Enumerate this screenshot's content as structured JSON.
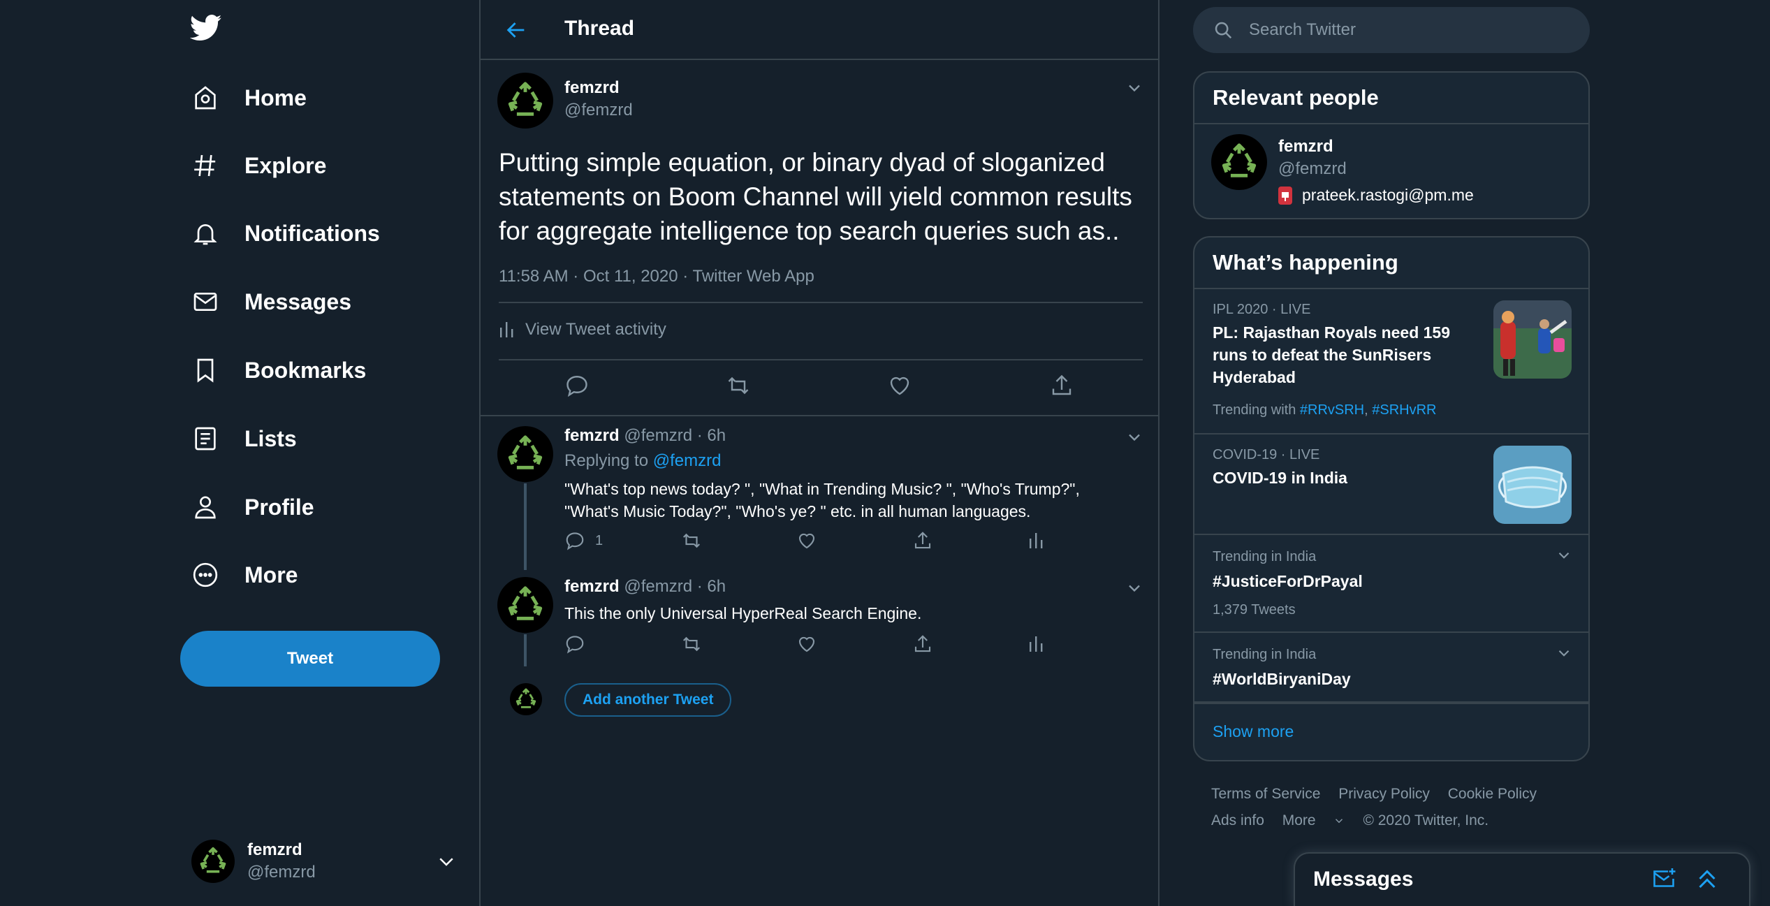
{
  "colors": {
    "background": "#15202b",
    "panel": "#192734",
    "border": "#38444d",
    "accent": "#1da1f2",
    "tweet_button": "#1a82c9",
    "muted": "#8899a6",
    "recycle_green": "#77b255"
  },
  "nav": {
    "logo_icon": "twitter-bird-icon",
    "items": [
      {
        "label": "Home",
        "icon": "home-icon"
      },
      {
        "label": "Explore",
        "icon": "hashtag-icon"
      },
      {
        "label": "Notifications",
        "icon": "bell-icon"
      },
      {
        "label": "Messages",
        "icon": "envelope-icon"
      },
      {
        "label": "Bookmarks",
        "icon": "bookmark-icon"
      },
      {
        "label": "Lists",
        "icon": "list-icon"
      },
      {
        "label": "Profile",
        "icon": "person-icon"
      },
      {
        "label": "More",
        "icon": "more-circle-icon"
      }
    ],
    "tweet_button": "Tweet",
    "account": {
      "name": "femzrd",
      "handle": "@femzrd"
    }
  },
  "thread": {
    "title": "Thread",
    "main_tweet": {
      "name": "femzrd",
      "handle": "@femzrd",
      "text": "Putting simple equation, or binary dyad of sloganized statements on Boom Channel will yield common results for aggregate intelligence top search queries such as..",
      "meta": "11:58 AM · Oct 11, 2020 · Twitter Web App",
      "activity": "View Tweet activity"
    },
    "replies": [
      {
        "name": "femzrd",
        "handle": "@femzrd",
        "time": " · 6h",
        "replying_prefix": "Replying to ",
        "replying_to": "@femzrd",
        "line1": "\"What's top news today? \", \"What in Trending Music? \",  \"Who's  Trump?\",",
        "line2": "\"What's Music Today?\", \"Who's ye? \" etc. in all human languages.",
        "reply_count": "1"
      },
      {
        "name": "femzrd",
        "handle": "@femzrd",
        "time": " · 6h",
        "text": "This the only Universal HyperReal Search Engine."
      }
    ],
    "add_another": "Add another Tweet"
  },
  "search": {
    "placeholder": "Search Twitter"
  },
  "relevant": {
    "title": "Relevant people",
    "person": {
      "name": "femzrd",
      "handle": "@femzrd",
      "bio": "prateek.rastogi@pm.me"
    }
  },
  "happening": {
    "title": "What’s happening",
    "trends": [
      {
        "category": "IPL 2020 · LIVE",
        "title_line1": "PL: Rajasthan Royals need 159",
        "title_line2": "runs to defeat the SunRisers",
        "title_line3": "Hyderabad",
        "trending_prefix": "Trending with ",
        "tag1": "#RRvSRH",
        "tag_sep": ", ",
        "tag2": "#SRHvRR"
      },
      {
        "category": "COVID-19 · LIVE",
        "title": "COVID-19 in India"
      },
      {
        "category": "Trending in India",
        "title": "#JusticeForDrPayal",
        "count": "1,379 Tweets"
      },
      {
        "category": "Trending in India",
        "title": "#WorldBiryaniDay"
      }
    ],
    "show_more": "Show more"
  },
  "footer": {
    "terms": "Terms of Service",
    "privacy": "Privacy Policy",
    "cookie": "Cookie Policy",
    "ads": "Ads info",
    "more": "More",
    "copyright": "© 2020 Twitter, Inc."
  },
  "messages_dock": {
    "title": "Messages"
  }
}
